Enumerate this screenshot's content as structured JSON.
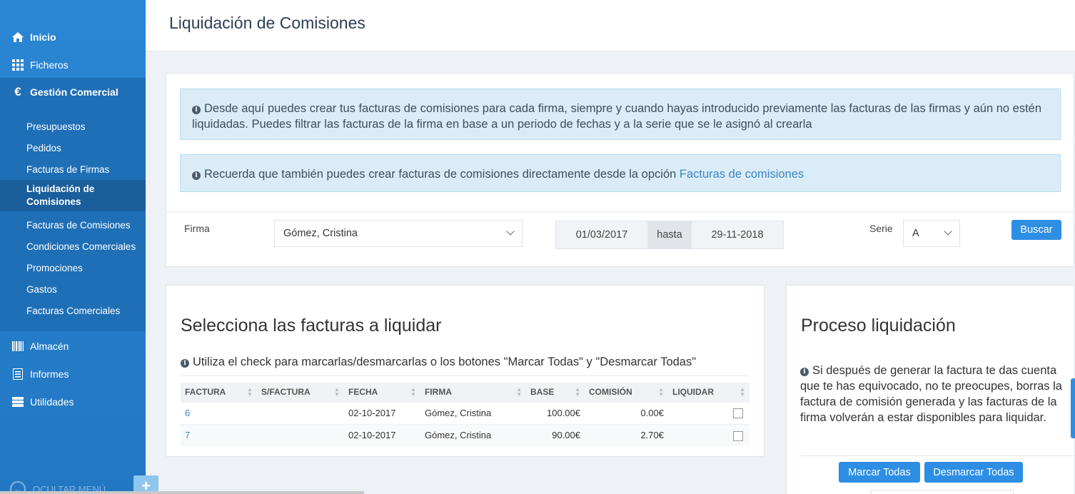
{
  "sidebar": {
    "main_items": [
      {
        "label": "Inicio",
        "icon": "home-icon"
      },
      {
        "label": "Ficheros",
        "icon": "grid-icon"
      },
      {
        "label": "Gestión Comercial",
        "icon": "euro-icon"
      },
      {
        "label": "Almacén",
        "icon": "barcode-icon"
      },
      {
        "label": "Informes",
        "icon": "list-icon"
      },
      {
        "label": "Utilidades",
        "icon": "server-icon"
      }
    ],
    "sub_items": [
      "Presupuestos",
      "Pedidos",
      "Facturas de Firmas",
      "Liquidación de Comisiones",
      "Facturas de Comisiones",
      "Condiciones Comerciales",
      "Promociones",
      "Gastos",
      "Facturas Comerciales"
    ],
    "hide_menu_label": "OCULTAR MENÚ",
    "plus_label": "+"
  },
  "header": {
    "title": "Liquidación de Comisiones"
  },
  "alerts": {
    "info1": "Desde aquí puedes crear tus facturas de comisiones para cada firma, siempre y cuando hayas introducido previamente las facturas de las firmas y aún no estén liquidadas. Puedes filtrar las facturas de la firma en base a un periodo de fechas y a la serie que se le asignó al crearla",
    "info2_prefix": "Recuerda que también puedes crear facturas de comisiones directamente desde la opción",
    "info2_link": "Facturas de comisiones"
  },
  "filters": {
    "firma_label": "Firma",
    "firma_value": "Gómez, Cristina",
    "date_from": "01/03/2017",
    "date_sep": "hasta",
    "date_to": "29-11-2018",
    "serie_label": "Serie",
    "serie_value": "A",
    "search_button": "Buscar"
  },
  "invoices": {
    "title": "Selecciona las facturas a liquidar",
    "hint": "Utiliza el check para marcarlas/desmarcarlas o los botones \"Marcar Todas\" y \"Desmarcar Todas\"",
    "columns": [
      "FACTURA",
      "S/FACTURA",
      "FECHA",
      "FIRMA",
      "BASE",
      "COMISIÓN",
      "LIQUIDAR"
    ],
    "rows": [
      {
        "factura": "6",
        "s_factura": "",
        "fecha": "02-10-2017",
        "firma": "Gómez, Cristina",
        "base": "100.00€",
        "comision": "0.00€",
        "liquidar": false
      },
      {
        "factura": "7",
        "s_factura": "",
        "fecha": "02-10-2017",
        "firma": "Gómez, Cristina",
        "base": "90.00€",
        "comision": "2.70€",
        "liquidar": false
      }
    ]
  },
  "process": {
    "title": "Proceso liquidación",
    "info": "Si después de generar la factura te das cuenta que te has equivocado, no te preocupes, borras la factura de comisión generada y las facturas de la firma volverán a estar disponibles para liquidar.",
    "mark_all": "Marcar Todas",
    "unmark_all": "Desmarcar Todas"
  }
}
